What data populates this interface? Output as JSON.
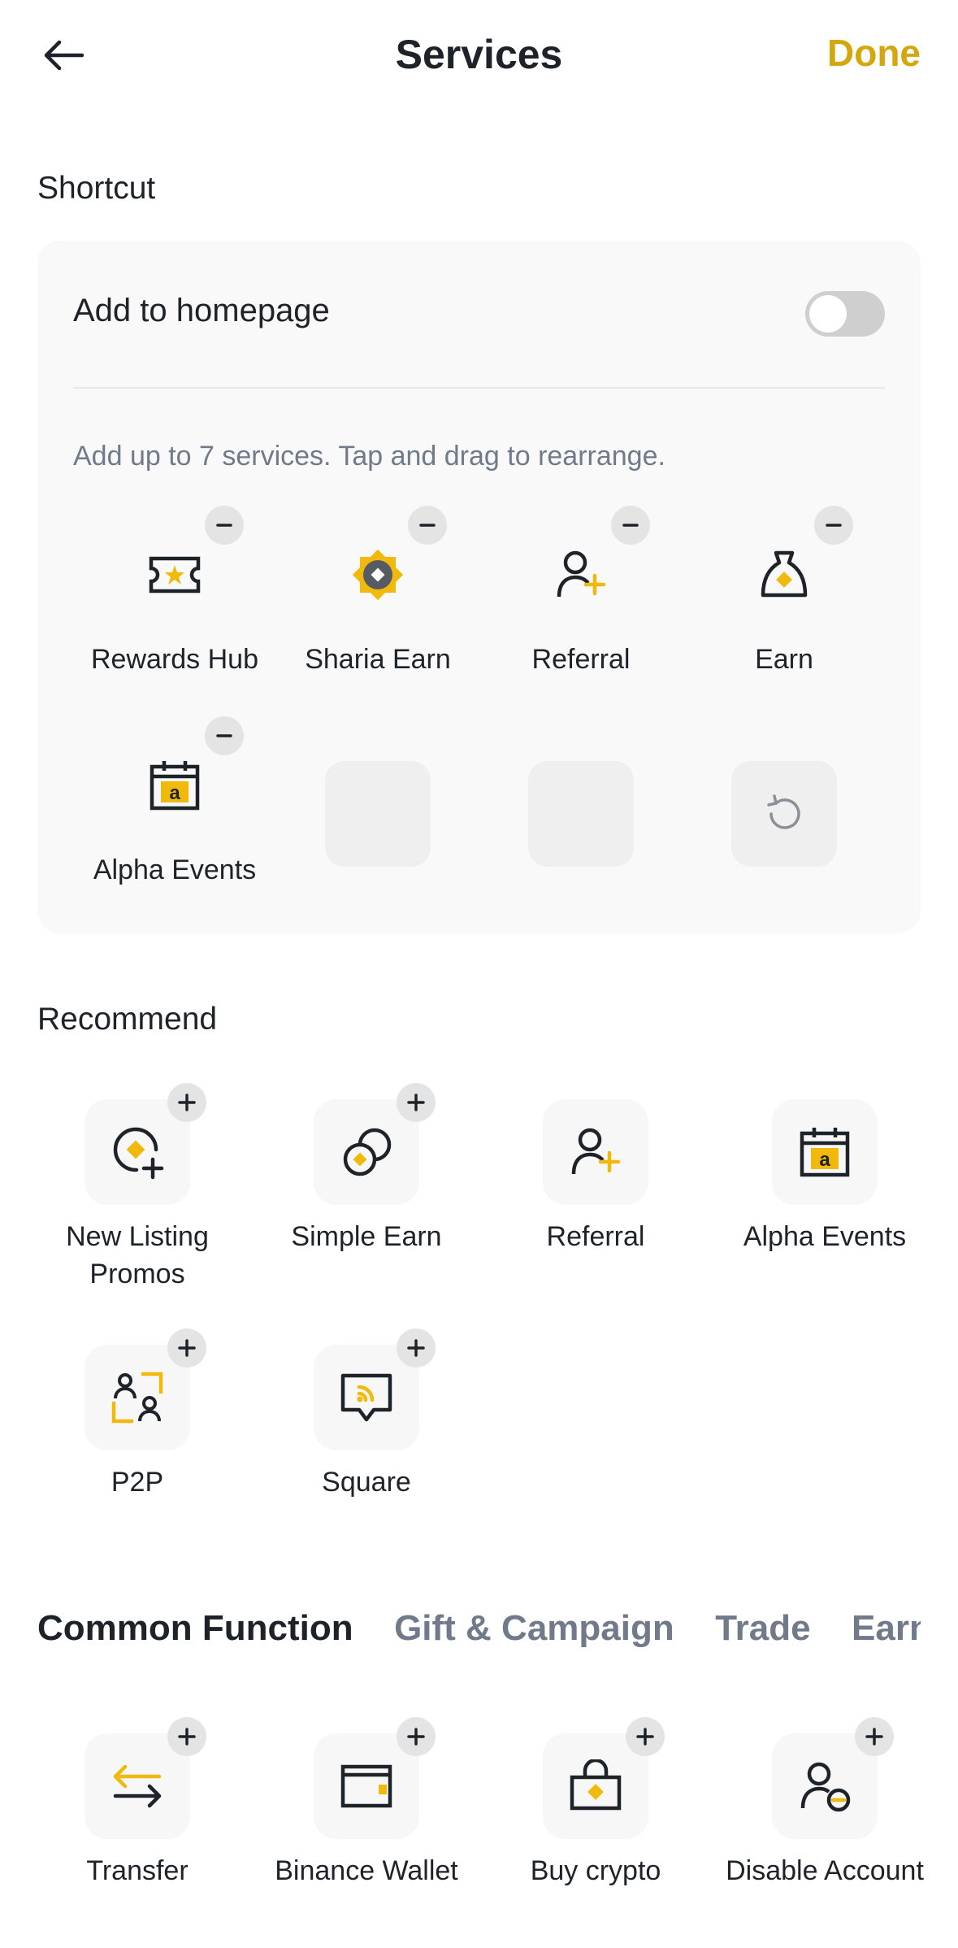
{
  "header": {
    "title": "Services",
    "done_label": "Done",
    "back_icon": "arrow-left-icon"
  },
  "shortcut": {
    "section_label": "Shortcut",
    "add_homepage_label": "Add to homepage",
    "add_homepage_enabled": false,
    "hint": "Add up to 7 services. Tap and drag to rearrange.",
    "items": [
      {
        "label": "Rewards Hub",
        "icon": "ticket-star-icon"
      },
      {
        "label": "Sharia Earn",
        "icon": "sharia-star-icon"
      },
      {
        "label": "Referral",
        "icon": "user-plus-icon"
      },
      {
        "label": "Earn",
        "icon": "money-bag-icon"
      },
      {
        "label": "Alpha Events",
        "icon": "calendar-alpha-icon"
      }
    ],
    "reset_icon": "reset-icon"
  },
  "recommend": {
    "section_label": "Recommend",
    "items": [
      {
        "label": "New Listing Promos",
        "icon": "new-listing-icon"
      },
      {
        "label": "Simple Earn",
        "icon": "coins-icon"
      },
      {
        "label": "Referral",
        "icon": "user-plus-icon"
      },
      {
        "label": "Alpha Events",
        "icon": "calendar-alpha-icon"
      },
      {
        "label": "P2P",
        "icon": "p2p-users-icon"
      },
      {
        "label": "Square",
        "icon": "chat-feed-icon"
      }
    ]
  },
  "tabs": [
    "Common Function",
    "Gift & Campaign",
    "Trade",
    "Earn"
  ],
  "common": {
    "items": [
      {
        "label": "Transfer",
        "icon": "transfer-arrows-icon"
      },
      {
        "label": "Binance Wallet",
        "icon": "wallet-icon"
      },
      {
        "label": "Buy crypto",
        "icon": "shopping-bag-icon"
      },
      {
        "label": "Disable Account",
        "icon": "user-minus-icon"
      }
    ]
  },
  "colors": {
    "accent": "#F0B90B",
    "done": "#D4A70E",
    "text": "#1E2329",
    "muted": "#707A8A"
  }
}
